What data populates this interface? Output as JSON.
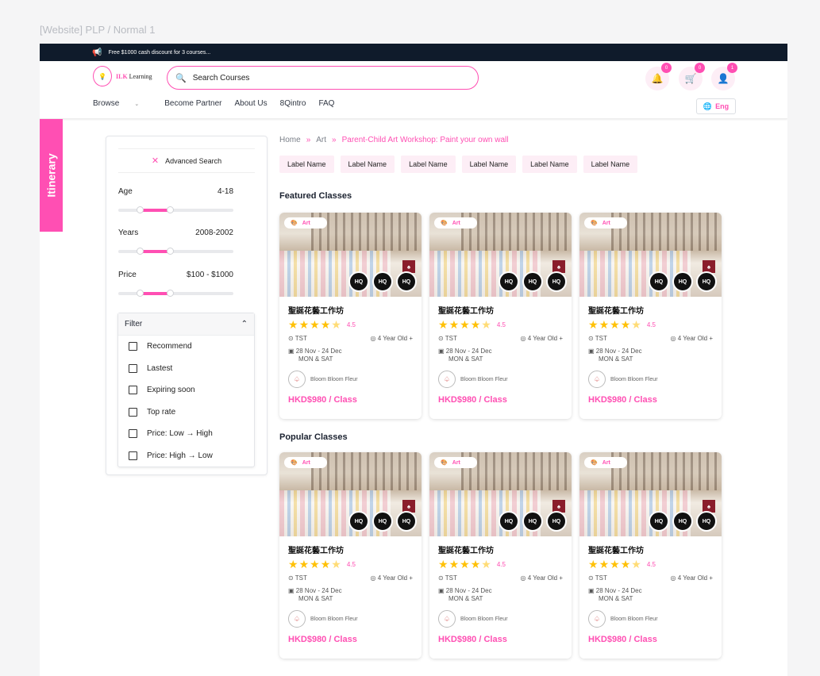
{
  "frame_label": "[Website] PLP / Normal 1",
  "announcement": {
    "icon": "megaphone-icon",
    "text": "Free $1000 cash discount for 3 courses..."
  },
  "logo": {
    "brand_prefix": "ILK",
    "brand_suffix": "Learning"
  },
  "search": {
    "placeholder": "Search Courses"
  },
  "header_icons": [
    {
      "name": "notification-bell-icon",
      "badge": "0"
    },
    {
      "name": "cart-icon",
      "badge": "0"
    },
    {
      "name": "user-icon",
      "badge": "1"
    }
  ],
  "nav": {
    "browse": "Browse",
    "partner": "Become Partner",
    "about": "About Us",
    "intro": "8Qintro",
    "faq": "FAQ"
  },
  "language": "Eng",
  "itinerary": "Itinerary",
  "sidebar": {
    "advanced_search": "Advanced Search",
    "age": {
      "label": "Age",
      "value": "4-18"
    },
    "years": {
      "label": "Years",
      "value": "2008-2002"
    },
    "price": {
      "label": "Price",
      "value": "$100 - $1000"
    },
    "filter_title": "Filter",
    "filters": [
      "Recommend",
      "Lastest",
      "Expiring soon",
      "Top rate",
      "Price: Low → High",
      "Price: High → Low"
    ]
  },
  "breadcrumb": {
    "home": "Home",
    "art": "Art",
    "current": "Parent-Child Art Workshop: Paint your own wall"
  },
  "labels": [
    "Label Name",
    "Label Name",
    "Label Name",
    "Label Name",
    "Label Name",
    "Label Name"
  ],
  "sections": {
    "featured": "Featured Classes",
    "popular": "Popular Classes"
  },
  "card": {
    "tag": "Art",
    "title": "聖誕花藝工作坊",
    "rating": "4.5",
    "location": "TST",
    "age": "4 Year Old +",
    "date_range": "28 Nov - 24 Dec",
    "days": "MON & SAT",
    "organizer": "Bloom Bloom Fleur",
    "price": "HKD$980 / Class",
    "hq": "HQ"
  },
  "colors": {
    "accent": "#ff4fb3",
    "dark": "#0f1b2b",
    "star": "#ffc107"
  }
}
